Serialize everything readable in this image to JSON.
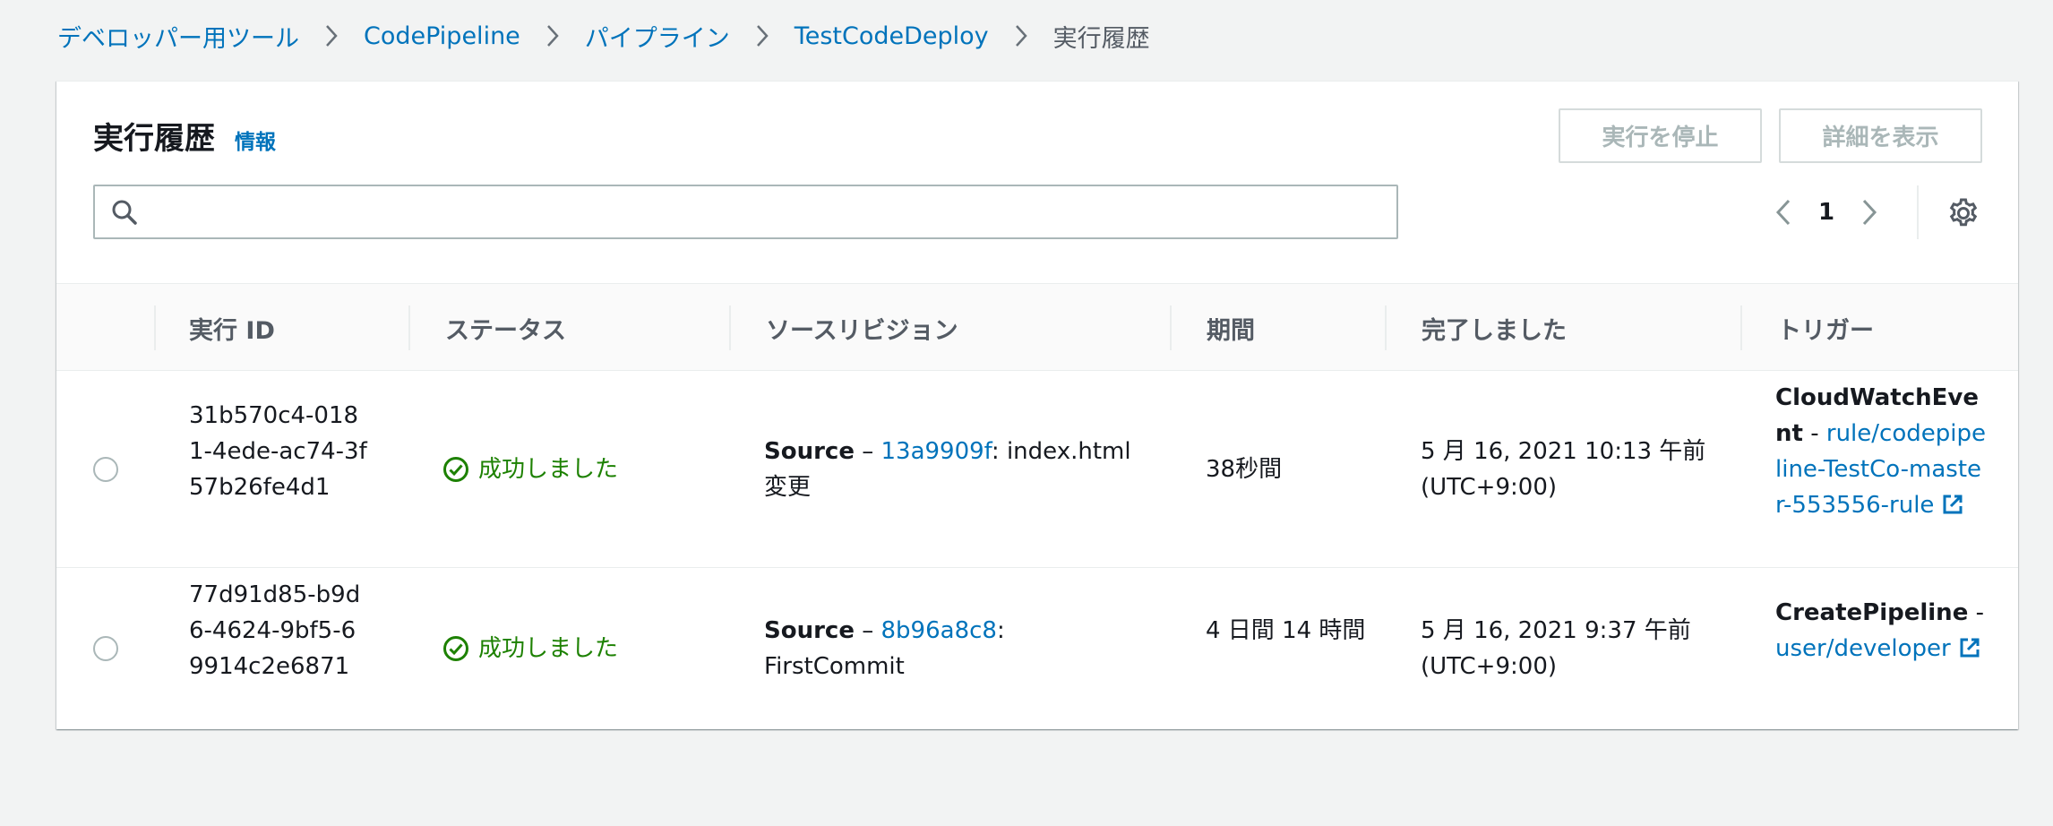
{
  "breadcrumb": {
    "items": [
      "デベロッパー用ツール",
      "CodePipeline",
      "パイプライン",
      "TestCodeDeploy",
      "実行履歴"
    ]
  },
  "panel": {
    "title": "実行履歴",
    "info_link": "情報",
    "stop_button": "実行を停止",
    "details_button": "詳細を表示",
    "search": {
      "value": "",
      "placeholder": ""
    },
    "pagination": {
      "current_page": "1"
    }
  },
  "table": {
    "columns": [
      "実行 ID",
      "ステータス",
      "ソースリビジョン",
      "期間",
      "完了しました",
      "トリガー"
    ],
    "rows": [
      {
        "execution_id": "31b570c4-0181-4ede-ac74-3f57b26fe4d1",
        "status": "成功しました",
        "source_label": "Source",
        "source_dash": " – ",
        "source_commit": "13a9909f",
        "source_message": ": index.html 変更",
        "duration": "38秒間",
        "completed": "5 月 16, 2021 10:13 午前 (UTC+9:00)",
        "trigger_type": "CloudWatchEvent",
        "trigger_sep": " - ",
        "trigger_link": "rule/codepipeline-TestCo-master-553556-rule"
      },
      {
        "execution_id": "77d91d85-b9d6-4624-9bf5-69914c2e6871",
        "status": "成功しました",
        "source_label": "Source",
        "source_dash": " – ",
        "source_commit": "8b96a8c8",
        "source_message": ": FirstCommit",
        "duration": "4 日間 14 時間",
        "completed": "5 月 16, 2021 9:37 午前 (UTC+9:00)",
        "trigger_type": "CreatePipeline",
        "trigger_sep": " - ",
        "trigger_link": "user/developer"
      }
    ]
  },
  "colors": {
    "link": "#0073bb",
    "success": "#1d8102",
    "disabled_text": "#aab7b8",
    "background": "#f2f3f3"
  },
  "icons": [
    "chevron-right-icon",
    "search-icon",
    "chevron-left-icon",
    "gear-icon",
    "check-circle-icon",
    "external-link-icon"
  ]
}
